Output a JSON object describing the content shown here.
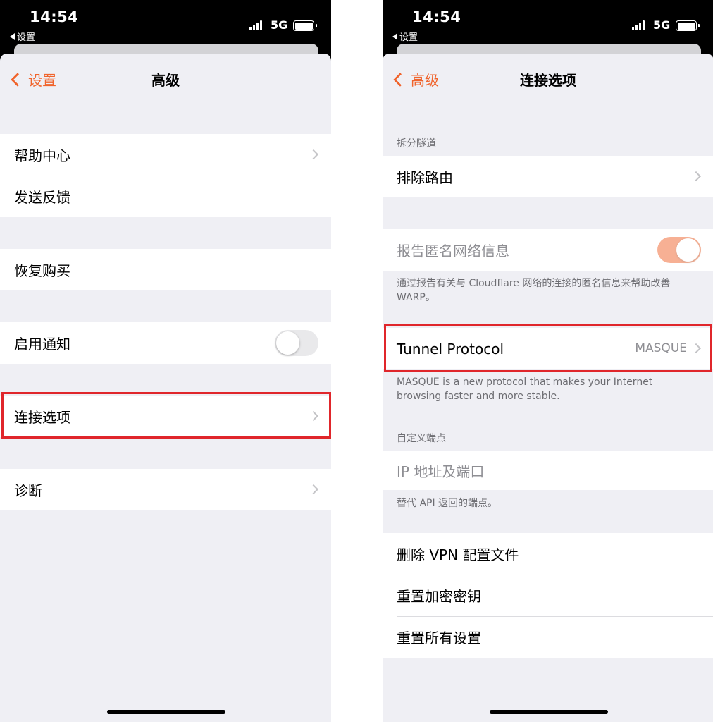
{
  "left": {
    "status": {
      "time": "14:54",
      "back": "设置",
      "network": "5G"
    },
    "nav": {
      "back_label": "设置",
      "title": "高级"
    },
    "rows": {
      "help_center": "帮助中心",
      "send_feedback": "发送反馈",
      "restore_purchases": "恢复购买",
      "enable_notifications": "启用通知",
      "connection_options": "连接选项",
      "diagnostics": "诊断"
    },
    "notifications_enabled": false
  },
  "right": {
    "status": {
      "time": "14:54",
      "back": "设置",
      "network": "5G"
    },
    "nav": {
      "back_label": "高级",
      "title": "连接选项"
    },
    "split_tunnel": {
      "header": "拆分隧道",
      "exclude_routes": "排除路由"
    },
    "anonymous_report": {
      "label": "报告匿名网络信息",
      "enabled": true,
      "footer": "通过报告有关与 Cloudflare 网络的连接的匿名信息来帮助改善 WARP。"
    },
    "tunnel_protocol": {
      "label": "Tunnel Protocol",
      "value": "MASQUE",
      "footer": "MASQUE is a new protocol that makes your Internet browsing faster and more stable."
    },
    "custom_endpoint": {
      "header": "自定义端点",
      "placeholder": "IP 地址及端口",
      "footer": "替代 API 返回的端点。"
    },
    "actions": {
      "delete_vpn_profile": "删除 VPN 配置文件",
      "reset_encryption_keys": "重置加密密钥",
      "reset_all_settings": "重置所有设置"
    }
  },
  "colors": {
    "accent": "#f0642c",
    "highlight_box": "#e0262b",
    "grouped_background": "#efeff4"
  }
}
